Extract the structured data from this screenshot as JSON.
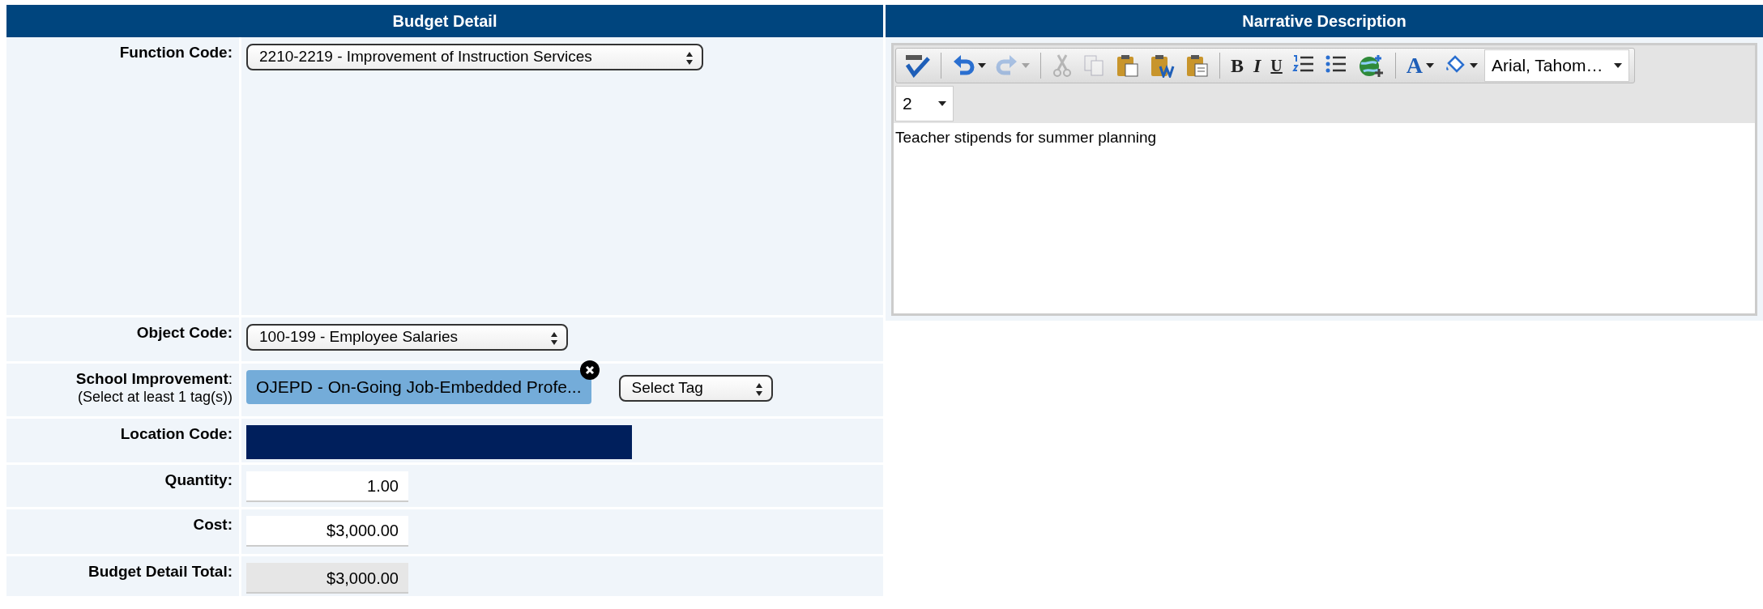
{
  "budget_detail": {
    "title": "Budget Detail",
    "fields": [
      {
        "kind": "select",
        "label": "Function Code:",
        "value": "2210-2219 - Improvement of Instruction Services"
      },
      {
        "kind": "select",
        "label": "Object Code:",
        "value": "100-199 - Employee Salaries"
      },
      {
        "kind": "tags",
        "label": "**School Improvement**:",
        "hint": "(Select at least 1 tag(s))",
        "tags": [
          {
            "text": "OJEPD - On-Going Job-Embedded Profe..."
          }
        ],
        "tag_select": "Select Tag"
      },
      {
        "kind": "location",
        "label": "Location Code:"
      },
      {
        "kind": "input",
        "label": "Quantity:",
        "value": "1.00"
      },
      {
        "kind": "input",
        "label": "Cost:",
        "value": "$3,000.00"
      },
      {
        "kind": "readonly",
        "label": "Budget Detail Total:",
        "value": "$3,000.00"
      }
    ]
  },
  "narrative": {
    "title": "Narrative Description",
    "toolbar": [
      {
        "kind": "spellcheck",
        "disabled": false
      },
      {
        "kind": "separator"
      },
      {
        "kind": "undo",
        "disabled": false,
        "caret": true
      },
      {
        "kind": "redo",
        "disabled": true,
        "caret": true
      },
      {
        "kind": "separator"
      },
      {
        "kind": "cut",
        "disabled": true
      },
      {
        "kind": "copy",
        "disabled": true
      },
      {
        "kind": "paste",
        "disabled": false
      },
      {
        "kind": "paste-word",
        "disabled": false
      },
      {
        "kind": "paste-text",
        "disabled": false
      },
      {
        "kind": "separator"
      },
      {
        "kind": "bold",
        "text": "B",
        "disabled": false
      },
      {
        "kind": "italic",
        "text": "I",
        "disabled": false
      },
      {
        "kind": "underline",
        "text": "U",
        "disabled": false
      },
      {
        "kind": "ordered-list",
        "disabled": false
      },
      {
        "kind": "bullet-list",
        "disabled": false
      },
      {
        "kind": "link",
        "disabled": false
      },
      {
        "kind": "separator"
      },
      {
        "kind": "font-color",
        "text": "A",
        "disabled": false,
        "caret": true
      },
      {
        "kind": "fill-color",
        "disabled": false,
        "caret": true
      }
    ],
    "font_select": "Arial, Tahom…",
    "size_select": "2",
    "text": "Teacher stipends for summer planning"
  }
}
